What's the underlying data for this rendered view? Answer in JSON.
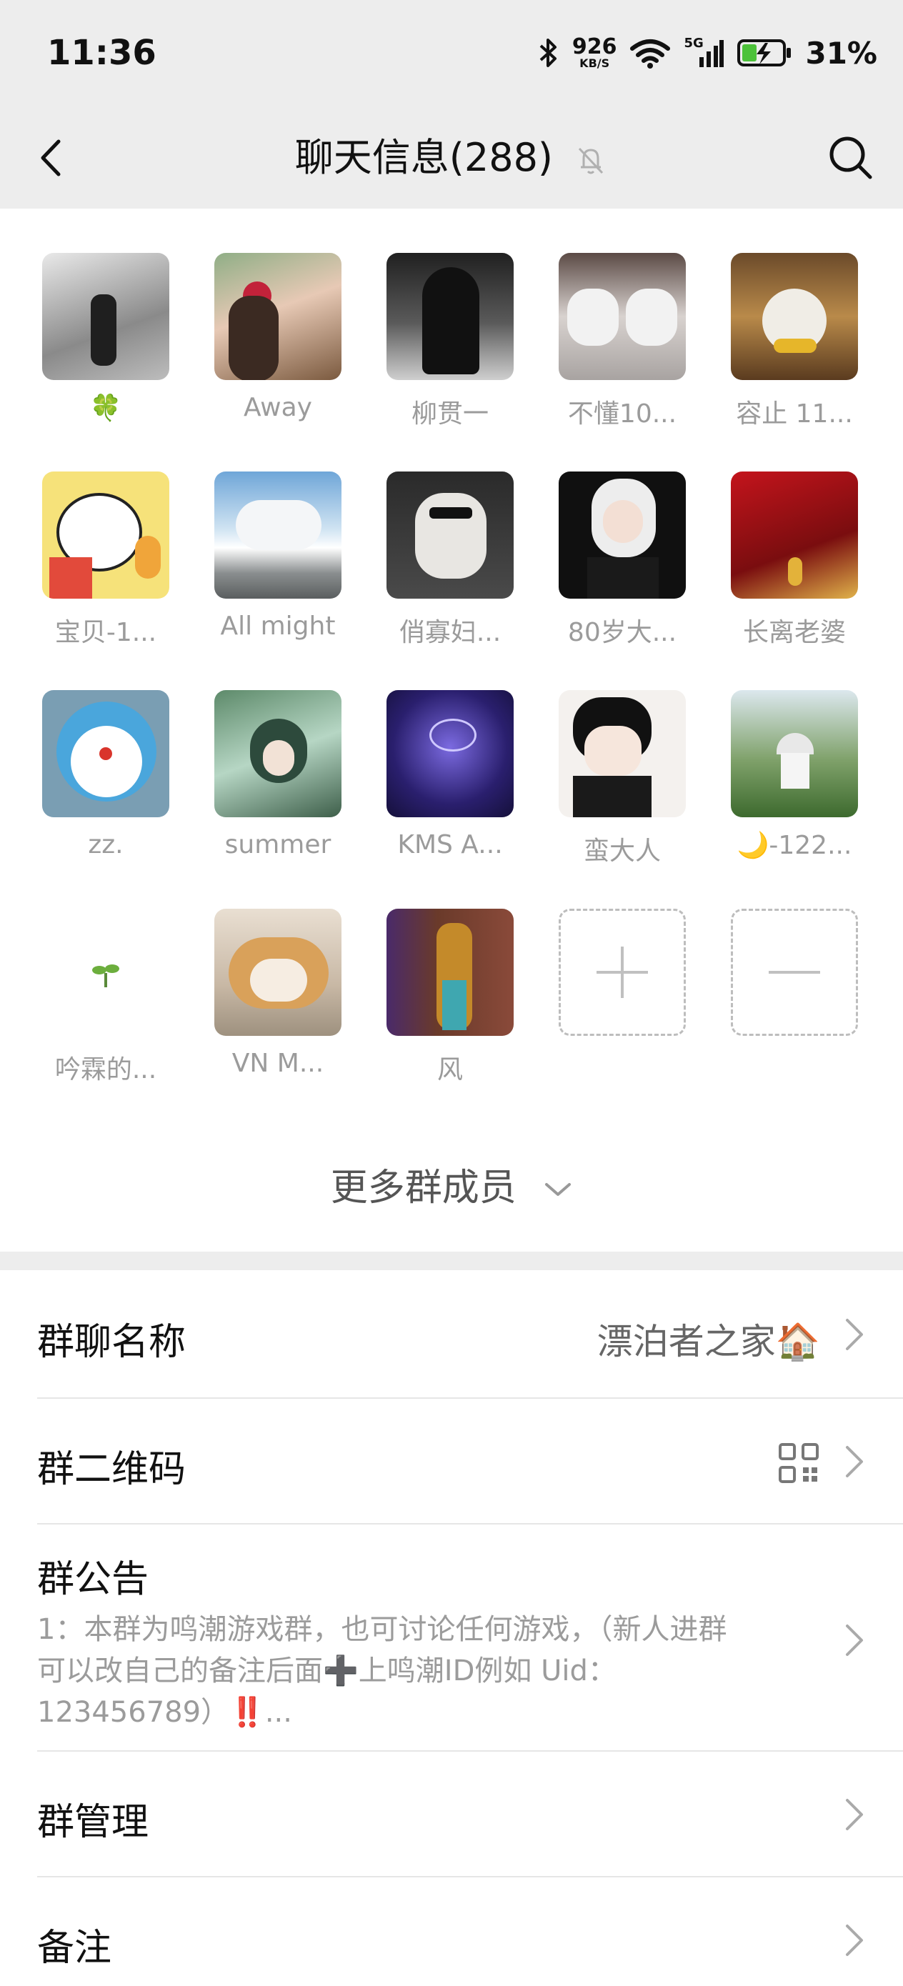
{
  "status_bar": {
    "time": "11:36",
    "net_speed_value": "926",
    "net_speed_unit": "KB/S",
    "network_type": "5G",
    "battery_percent": "31%"
  },
  "header": {
    "title": "聊天信息(288)"
  },
  "members": [
    {
      "name": "🍀",
      "icon": "street-photo"
    },
    {
      "name": "Away",
      "icon": "girl-with-rose"
    },
    {
      "name": "柳贯一",
      "icon": "dark-anime"
    },
    {
      "name": "不懂10...",
      "icon": "husky-dogs"
    },
    {
      "name": "容止 11...",
      "icon": "cat"
    },
    {
      "name": "宝贝-1...",
      "icon": "cartoon-puppy"
    },
    {
      "name": "All might",
      "icon": "clouds"
    },
    {
      "name": "俏寡妇...",
      "icon": "plush-toy"
    },
    {
      "name": "80岁大...",
      "icon": "white-hair-anime"
    },
    {
      "name": "长离老婆",
      "icon": "red-hair-anime"
    },
    {
      "name": "zz.",
      "icon": "doraemon"
    },
    {
      "name": "summer",
      "icon": "flower-anime"
    },
    {
      "name": "KMS A...",
      "icon": "purple-logo"
    },
    {
      "name": "蛮大人",
      "icon": "anime-boy"
    },
    {
      "name": "🌙-122...",
      "icon": "gazebo-park"
    },
    {
      "name": "吟霖的...",
      "icon": "sprout"
    },
    {
      "name": "VN   M...",
      "icon": "shiba-dog"
    },
    {
      "name": "风",
      "icon": "street-man"
    }
  ],
  "more_members_label": "更多群成员",
  "settings": {
    "group_name_label": "群聊名称",
    "group_name_value": "漂泊者之家🏠",
    "qr_label": "群二维码",
    "notice_label": "群公告",
    "notice_text": "1：本群为鸣潮游戏群，也可讨论任何游戏，（新人进群可以改自己的备注后面➕上鸣潮ID例如 Uid：123456789）‼️...",
    "manage_label": "群管理",
    "remark_label": "备注"
  },
  "colors": {
    "header_bg": "#ededed",
    "secondary_text": "#9b9b9b"
  }
}
